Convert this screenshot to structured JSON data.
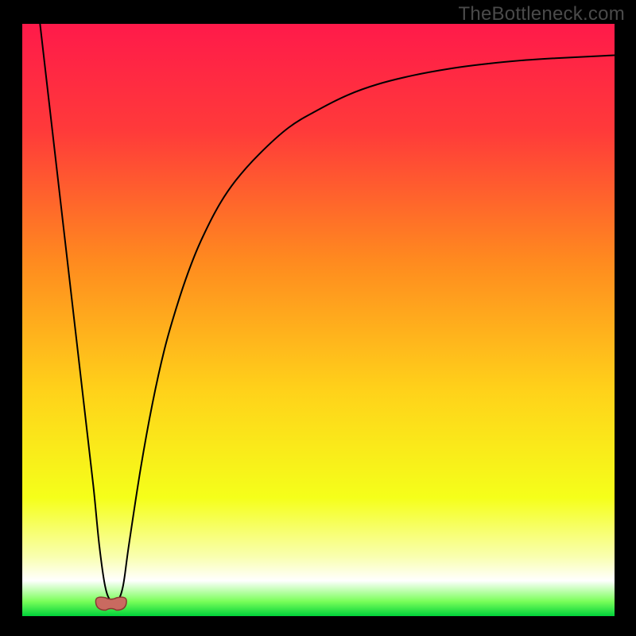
{
  "watermark": "TheBottleneck.com",
  "chart_data": {
    "type": "line",
    "title": "",
    "xlabel": "",
    "ylabel": "",
    "xlim": [
      0,
      100
    ],
    "ylim": [
      0,
      100
    ],
    "grid": false,
    "legend": false,
    "background_gradient": {
      "stops": [
        {
          "offset": 0.0,
          "color": "#ff1a4a"
        },
        {
          "offset": 0.18,
          "color": "#ff3a3a"
        },
        {
          "offset": 0.4,
          "color": "#ff8a1f"
        },
        {
          "offset": 0.62,
          "color": "#ffd21a"
        },
        {
          "offset": 0.8,
          "color": "#f5ff1a"
        },
        {
          "offset": 0.9,
          "color": "#f9ffb0"
        },
        {
          "offset": 0.94,
          "color": "#ffffff"
        },
        {
          "offset": 0.975,
          "color": "#7aff5a"
        },
        {
          "offset": 1.0,
          "color": "#00d23a"
        }
      ]
    },
    "series": [
      {
        "name": "bottleneck-curve",
        "stroke": "#000000",
        "stroke_width": 2,
        "x": [
          3.0,
          4.5,
          6.0,
          7.5,
          9.0,
          10.5,
          12.0,
          13.0,
          14.0,
          15.0,
          16.0,
          17.0,
          18.0,
          20.0,
          22.0,
          24.0,
          26.0,
          28.0,
          30.0,
          33.0,
          36.0,
          40.0,
          45.0,
          50.0,
          55.0,
          60.0,
          66.0,
          72.0,
          78.0,
          84.0,
          90.0,
          96.0,
          100.0
        ],
        "y": [
          100.0,
          87.0,
          74.0,
          61.0,
          48.0,
          35.0,
          22.0,
          12.0,
          5.0,
          2.5,
          2.5,
          5.0,
          12.0,
          25.0,
          36.0,
          45.0,
          52.0,
          58.0,
          63.0,
          69.0,
          73.5,
          78.0,
          82.5,
          85.5,
          88.0,
          89.8,
          91.3,
          92.4,
          93.2,
          93.8,
          94.2,
          94.5,
          94.7
        ]
      }
    ],
    "markers": [
      {
        "name": "sweet-spot-marker",
        "shape": "blob",
        "cx": 15.0,
        "cy": 2.2,
        "rx": 2.6,
        "ry": 1.2,
        "fill": "#c96a60",
        "stroke": "#8a3a33"
      }
    ]
  }
}
